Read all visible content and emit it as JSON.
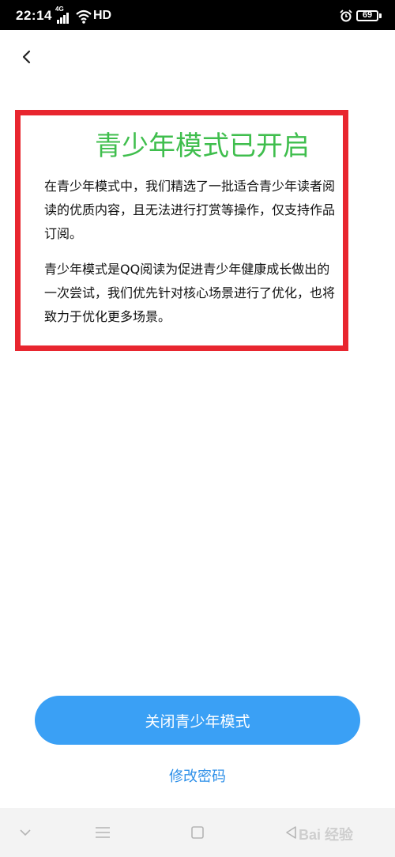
{
  "status_bar": {
    "time": "22:14",
    "network": "4G",
    "hd": "HD",
    "battery": "69"
  },
  "header": {
    "back_icon": "chevron-left-icon"
  },
  "notice": {
    "title": "青少年模式已开启",
    "title_color": "#3fbe4d",
    "highlight_color": "#e8262f",
    "paragraph1_lines": [
      "在青少年模式中，我们精选了一批适合青少年读者阅",
      "读的优质内容，且无法进行打赏等操作，仅支持作品",
      "订阅。"
    ],
    "paragraph2_lines": [
      "青少年模式是QQ阅读为促进青少年健康成长做出的",
      "一次尝试，我们优先针对核心场景进行了优化，也将",
      "致力于优化更多场景。"
    ]
  },
  "actions": {
    "close_mode_label": "关闭青少年模式",
    "change_password_label": "修改密码",
    "accent_color": "#3aa0f5"
  },
  "nav_bar": {
    "icons": [
      "chevron-down-icon",
      "menu-icon",
      "home-square-icon",
      "back-triangle-icon"
    ]
  },
  "watermark": {
    "text": "Bai 经验"
  }
}
